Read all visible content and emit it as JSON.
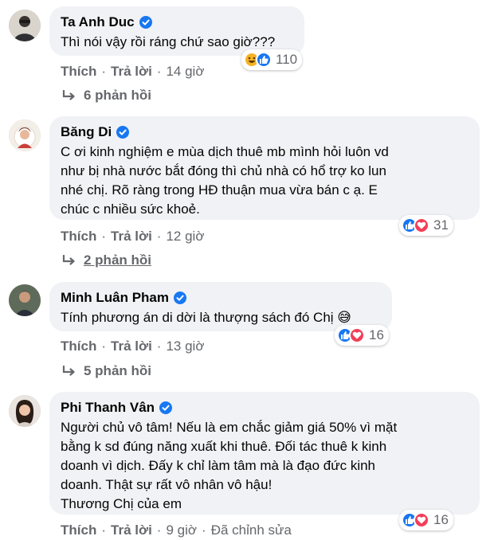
{
  "labels": {
    "like": "Thích",
    "reply": "Trả lời",
    "separator": "·"
  },
  "colors": {
    "bubble": "#f0f2f5",
    "secondary_text": "#65676b",
    "verified": "#1877f2",
    "like": "#1877f2",
    "love": "#f33e58",
    "haha": "#f7b125"
  },
  "comments": [
    {
      "author": "Ta Anh Duc",
      "verified": true,
      "lines": [
        "Thì nói vậy rồi ráng chứ sao giờ???"
      ],
      "reaction_icons": [
        "haha-icon",
        "like-icon"
      ],
      "reaction_count": "110",
      "time": "14 giờ",
      "replies_label": "6 phản hồi"
    },
    {
      "author": "Băng Di",
      "verified": true,
      "lines": [
        "C ơi kinh nghiệm e mùa dịch thuê mb mình hỏi luôn vd",
        "như bị nhà nước bắt đóng thì chủ nhà có hổ trợ ko lun",
        "nhé chị. Rõ ràng trong HĐ thuận mua vừa bán c ạ. E",
        "chúc c nhiều sức khoẻ."
      ],
      "reaction_icons": [
        "like-icon",
        "love-icon"
      ],
      "reaction_count": "31",
      "time": "12 giờ",
      "replies_label": "2 phản hồi"
    },
    {
      "author": "Minh Luân Pham",
      "verified": true,
      "lines": [
        "Tính phương án di dời là thượng sách đó Chị 😅"
      ],
      "reaction_icons": [
        "like-icon",
        "love-icon"
      ],
      "reaction_count": "16",
      "time": "13 giờ",
      "replies_label": "5 phản hồi"
    },
    {
      "author": "Phi Thanh Vân",
      "verified": true,
      "lines": [
        "Người chủ vô tâm! Nếu là em chắc giảm giá 50% vì mặt",
        "bằng k sd đúng năng xuất khi thuê. Đối tác thuê k kinh",
        "doanh vì dịch. Đấy k chỉ làm tâm mà là đạo đức kinh",
        "doanh. Thật sự rất vô nhân vô hậu!",
        "Thương Chị của em"
      ],
      "reaction_icons": [
        "like-icon",
        "love-icon"
      ],
      "reaction_count": "16",
      "time": "9 giờ",
      "edited_label": "Đã chỉnh sửa"
    }
  ]
}
